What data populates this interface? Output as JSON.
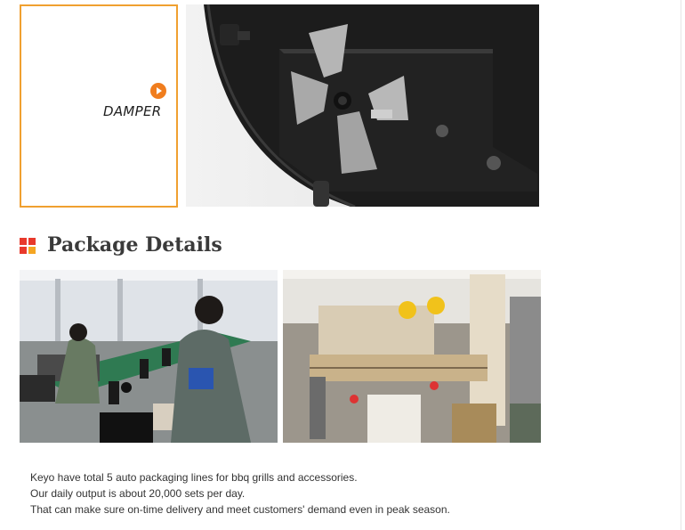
{
  "damper": {
    "label": "DAMPER",
    "play_icon": "play-circle-icon",
    "accent_color": "#f07d1e",
    "border_color": "#f0a030"
  },
  "package": {
    "heading": "Package Details",
    "heading_icon": "four-squares-icon",
    "heading_icon_colors": [
      "#e8392b",
      "#e8392b",
      "#e8392b",
      "#f5a623"
    ]
  },
  "description": {
    "lines": [
      "Keyo have total 5 auto packaging lines for bbq grills and accessories.",
      "Our daily output is about 20,000 sets per day.",
      "That can make sure on-time delivery and meet customers' demand even in peak season."
    ]
  }
}
